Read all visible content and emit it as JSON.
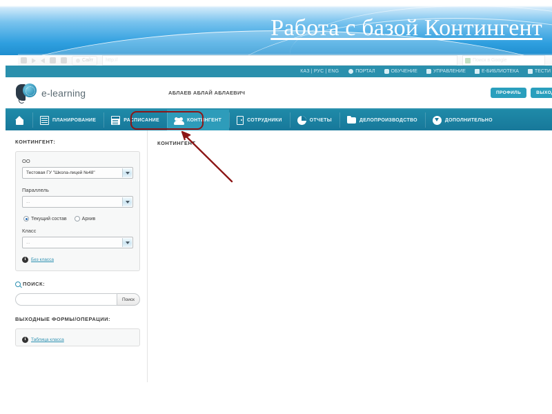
{
  "slide": {
    "title": "Работа с базой Контингент"
  },
  "browser": {
    "bookmark_label": "Сайт",
    "address_value": "http://",
    "search_placeholder": "Поиск в Google",
    "back_icon": "back-arrow-icon",
    "forward_icon": "forward-arrow-icon"
  },
  "top_strip": {
    "languages": [
      "КАЗ",
      "РУС",
      "ENG"
    ],
    "separator": "|",
    "links": [
      {
        "label": "ПОРТАЛ",
        "icon": "globe-icon"
      },
      {
        "label": "ОБУЧЕНИЕ",
        "icon": "check-icon"
      },
      {
        "label": "УПРАВЛЕНИЕ",
        "icon": "book-icon"
      },
      {
        "label": "Е-БИБЛИОТЕКА",
        "icon": "book-icon"
      },
      {
        "label": "ТЕСТИ",
        "icon": "book-icon"
      }
    ]
  },
  "header": {
    "logo_text": "e-learning",
    "logo_icon": "book-globe-icon",
    "user_name": "АБЛАЕВ АБЛАЙ АБЛАЕВИЧ",
    "profile_button": "ПРОФИЛЬ",
    "logout_button": "ВЫХОД"
  },
  "nav": {
    "home_icon": "home-icon",
    "items": [
      {
        "label": "ПЛАНИРОВАНИЕ",
        "icon": "grid-icon",
        "active": false
      },
      {
        "label": "РАСПИСАНИЕ",
        "icon": "calendar-icon",
        "active": false
      },
      {
        "label": "КОНТИНГЕНТ",
        "icon": "people-icon",
        "active": true
      },
      {
        "label": "СОТРУДНИКИ",
        "icon": "door-icon",
        "active": false
      },
      {
        "label": "ОТЧЕТЫ",
        "icon": "pie-chart-icon",
        "active": false
      },
      {
        "label": "ДЕЛОПРОИЗВОДСТВО",
        "icon": "folder-icon",
        "active": false
      },
      {
        "label": "ДОПОЛНИТЕЛЬНО",
        "icon": "down-arrow-circle-icon",
        "active": false
      }
    ]
  },
  "sidebar": {
    "contingent_heading": "КОНТИНГЕНТ:",
    "oo_label": "ОО",
    "oo_value": "Тестовая ГУ \"Школа-лицей №48\"",
    "parallel_label": "Параллель",
    "parallel_value": "...",
    "status_radios": [
      {
        "label": "Текущий состав",
        "selected": true
      },
      {
        "label": "Архив",
        "selected": false
      }
    ],
    "class_label": "Класс",
    "class_value": "...",
    "no_class_link": "Без класса",
    "no_class_icon": "info-icon",
    "search_heading": "ПОИСК:",
    "search_icon": "search-icon",
    "search_value": "",
    "search_placeholder": "",
    "search_button": "Поиск",
    "forms_heading": "ВЫХОДНЫЕ ФОРМЫ/ОПЕРАЦИИ:",
    "forms_link": "Таблица класса",
    "forms_link_icon": "info-icon"
  },
  "main": {
    "heading": "КОНТИНГЕНТ"
  },
  "annotation": {
    "color": "#8c1616",
    "target": "КОНТИНГЕНТ"
  },
  "colors": {
    "banner_blue": "#2f9fdf",
    "nav_teal": "#17789a",
    "nav_active_teal": "#2e9cba",
    "strip_teal": "#2a90ad",
    "link_teal": "#2a8fb0",
    "annotation_red": "#8c1616"
  }
}
